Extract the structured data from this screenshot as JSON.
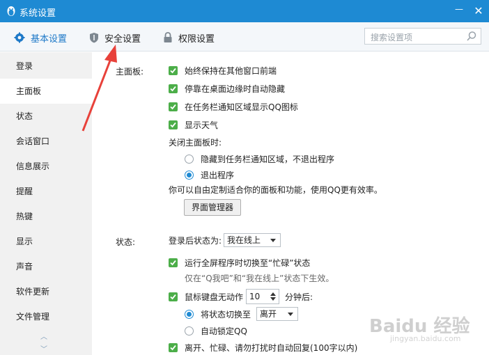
{
  "window": {
    "title": "系统设置",
    "minimize": "—",
    "close": "✕"
  },
  "tabs": [
    {
      "label": "基本设置",
      "icon": "gear-icon",
      "active": true
    },
    {
      "label": "安全设置",
      "icon": "shield-icon",
      "active": false
    },
    {
      "label": "权限设置",
      "icon": "lock-icon",
      "active": false
    }
  ],
  "search": {
    "placeholder": "搜索设置项"
  },
  "sidebar": {
    "items": [
      "登录",
      "主面板",
      "状态",
      "会话窗口",
      "信息展示",
      "提醒",
      "热键",
      "显示",
      "声音",
      "软件更新",
      "文件管理"
    ],
    "active": "主面板"
  },
  "panel": {
    "label": "主面板:",
    "options": [
      "始终保持在其他窗口前端",
      "停靠在桌面边缘时自动隐藏",
      "在任务栏通知区域显示QQ图标",
      "显示天气"
    ],
    "close_label": "关闭主面板时:",
    "close_options": [
      "隐藏到任务栏通知区域，不退出程序",
      "退出程序"
    ],
    "close_selected": "退出程序",
    "note": "你可以自由定制适合你的面板和功能，使用QQ更有效率。",
    "manager_button": "界面管理器"
  },
  "status": {
    "label": "状态:",
    "after_login_label": "登录后状态为:",
    "after_login_value": "我在线上",
    "fullscreen_option": "运行全屏程序时切换至“忙碌”状态",
    "fullscreen_note": "仅在“Q我吧”和“我在线上”状态下生效。",
    "idle_prefix": "鼠标键盘无动作",
    "idle_minutes": "10",
    "idle_suffix": "分钟后:",
    "switch_label": "将状态切换至",
    "switch_value": "离开",
    "autolock_label": "自动锁定QQ",
    "autoreply_option": "离开、忙碌、请勿打扰时自动回复(100字以内)"
  },
  "watermark": {
    "text": "Baidu 经验",
    "sub": "jingyan.baidu.com"
  },
  "colors": {
    "titlebar": "#1e8ad3",
    "checkbox": "#4cae49",
    "accent": "#1e79c8",
    "arrow": "#e8413a"
  }
}
